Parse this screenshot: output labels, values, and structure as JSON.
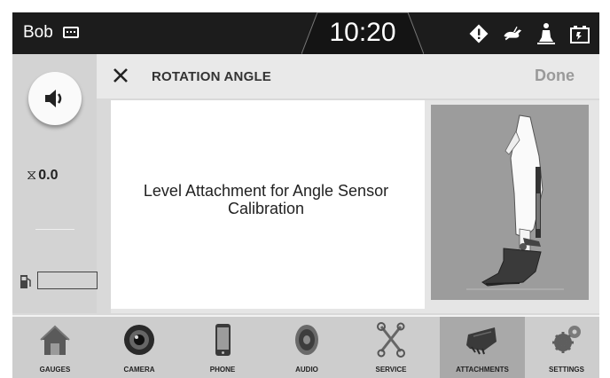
{
  "status_bar": {
    "operator": "Bob",
    "time": "10:20",
    "icons": [
      "keypad-icon",
      "warning-icon",
      "rabbit-speed-icon",
      "seated-operator-icon",
      "battery-icon"
    ]
  },
  "left_rail": {
    "hour_meter": "0.0",
    "fuel_level_fraction": 0
  },
  "dialog": {
    "title": "ROTATION ANGLE",
    "done_label": "Done",
    "message": "Level Attachment for Angle Sensor Calibration"
  },
  "nav": {
    "items": [
      {
        "label": "GAUGES",
        "icon": "house-icon"
      },
      {
        "label": "CAMERA",
        "icon": "camera-icon"
      },
      {
        "label": "PHONE",
        "icon": "phone-icon"
      },
      {
        "label": "AUDIO",
        "icon": "speaker-icon"
      },
      {
        "label": "SERVICE",
        "icon": "wrench-icon"
      },
      {
        "label": "ATTACHMENTS",
        "icon": "bucket-icon"
      },
      {
        "label": "SETTINGS",
        "icon": "gears-icon"
      }
    ],
    "active": "ATTACHMENTS"
  },
  "colors": {
    "topbar": "#1c1c1c",
    "rail": "#d3d3d3",
    "active_nav": "#a9a9a9"
  }
}
